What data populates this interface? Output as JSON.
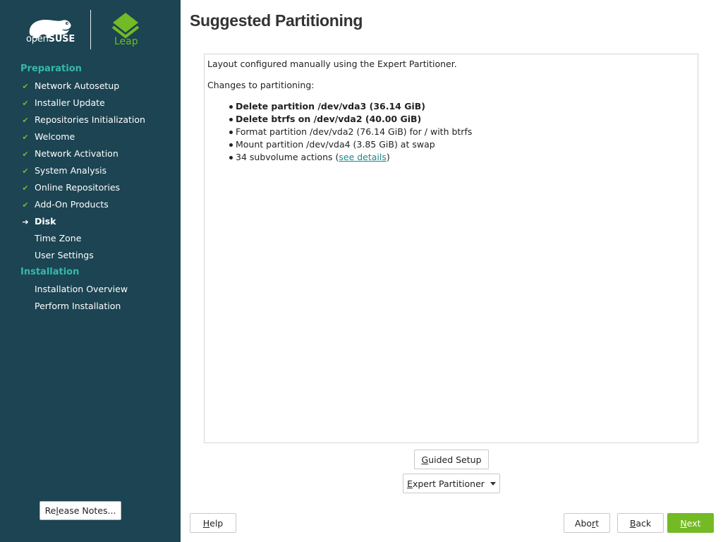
{
  "colors": {
    "sidebar_bg": "#1c4452",
    "heading_teal": "#35b9ab",
    "check_green": "#73ba25",
    "next_button_bg": "#73ba25",
    "link_teal": "#1a8a8a"
  },
  "branding": {
    "opensuse_prefix": "open",
    "opensuse_suffix": "SUSE",
    "leap_label": "Leap",
    "opensuse_logo_icon": "chameleon-logo-icon",
    "leap_logo_icon": "leap-diamond-icon"
  },
  "sidebar": {
    "sections": [
      {
        "heading": "Preparation",
        "steps": [
          {
            "label": "Network Autosetup",
            "state": "done",
            "icon": "check-icon"
          },
          {
            "label": "Installer Update",
            "state": "done",
            "icon": "check-icon"
          },
          {
            "label": "Repositories Initialization",
            "state": "done",
            "icon": "check-icon"
          },
          {
            "label": "Welcome",
            "state": "done",
            "icon": "check-icon"
          },
          {
            "label": "Network Activation",
            "state": "done",
            "icon": "check-icon"
          },
          {
            "label": "System Analysis",
            "state": "done",
            "icon": "check-icon"
          },
          {
            "label": "Online Repositories",
            "state": "done",
            "icon": "check-icon"
          },
          {
            "label": "Add-On Products",
            "state": "done",
            "icon": "check-icon"
          },
          {
            "label": "Disk",
            "state": "current",
            "icon": "arrow-right-icon"
          },
          {
            "label": "Time Zone",
            "state": "pending"
          },
          {
            "label": "User Settings",
            "state": "pending"
          }
        ]
      },
      {
        "heading": "Installation",
        "steps": [
          {
            "label": "Installation Overview",
            "state": "pending"
          },
          {
            "label": "Perform Installation",
            "state": "pending"
          }
        ]
      }
    ],
    "release_notes": {
      "pre": "Re",
      "accel": "l",
      "post": "ease Notes..."
    }
  },
  "main": {
    "title": "Suggested Partitioning",
    "summary": {
      "intro": "Layout configured manually using the Expert Partitioner.",
      "changes_heading": "Changes to partitioning:",
      "changes": [
        {
          "text": "Delete partition /dev/vda3 (36.14 GiB)",
          "bold": true
        },
        {
          "text": "Delete btrfs on /dev/vda2 (40.00 GiB)",
          "bold": true
        },
        {
          "text": "Format partition /dev/vda2 (76.14 GiB) for / with btrfs",
          "bold": false
        },
        {
          "text": "Mount partition /dev/vda4 (3.85 GiB) at swap",
          "bold": false
        }
      ],
      "subvolume": {
        "prefix": "34 subvolume actions (",
        "link": "see details",
        "suffix": ")"
      }
    },
    "guided_setup": {
      "accel": "G",
      "post": "uided Setup"
    },
    "expert_partitioner": {
      "accel": "E",
      "post": "xpert Partitioner"
    }
  },
  "footer": {
    "help": {
      "accel": "H",
      "post": "elp"
    },
    "abort": {
      "pre": "Abo",
      "accel": "r",
      "post": "t"
    },
    "back": {
      "accel": "B",
      "post": "ack"
    },
    "next": {
      "accel": "N",
      "post": "ext"
    }
  }
}
